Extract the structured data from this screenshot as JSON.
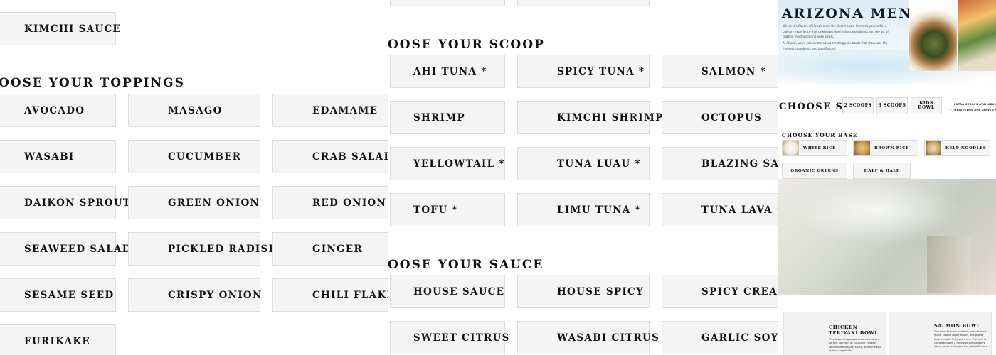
{
  "left": {
    "sauce_continued": {
      "label": "KIMCHI SAUCE"
    },
    "toppings_heading": "OOSE YOUR TOPPINGS",
    "toppings": [
      [
        "AVOCADO",
        "MASAGO",
        "EDAMAME"
      ],
      [
        "WASABI",
        "CUCUMBER",
        "CRAB SALAD"
      ],
      [
        "DAIKON SPROUT",
        "GREEN ONION",
        "RED ONION"
      ],
      [
        "SEAWEED SALAD",
        "PICKLED RADISH",
        "GINGER"
      ],
      [
        "SESAME SEED",
        "CRISPY ONION",
        "CHILI FLAKES"
      ],
      [
        "FURIKAKE"
      ]
    ]
  },
  "middle": {
    "scoop_heading": "OOSE YOUR SCOOP",
    "scoops": [
      [
        "AHI TUNA *",
        "SPICY TUNA *",
        "SALMON *"
      ],
      [
        "SHRIMP",
        "KIMCHI SHRIMP",
        "OCTOPUS"
      ],
      [
        "YELLOWTAIL *",
        "TUNA LUAU *",
        "BLAZING SALMON"
      ],
      [
        "TOFU *",
        "LIMU TUNA *",
        "TUNA LAVA *"
      ]
    ],
    "sauce_heading": "OOSE YOUR SAUCE",
    "sauces": [
      [
        "HOUSE SAUCE",
        "HOUSE SPICY",
        "SPICY CREAMY"
      ],
      [
        "SWEET CITRUS",
        "WASABI CITRUS",
        "GARLIC SOY MIRIN"
      ]
    ]
  },
  "right": {
    "title": "ARIZONA MENU",
    "intro": "Where the flavors of Hawaii meet the desert oasis. Immerse yourself in a culinary experience that celebrates the freshest ingredients and the art of crafting mouthwatering poke bowls.",
    "intro2": "At Alipoki, we're passionate about creating poke bowls that showcase the freshest ingredients and bold flavors.",
    "size_label": "CHOOSE SIZE",
    "sizes": [
      "2 SCOOPS",
      "3 SCOOPS",
      "KIDS BOWL"
    ],
    "size_note_1": "EXTRA SCOOPS AVAILABLE",
    "size_note_2": "* THESE ITEMS ARE SERVED RAW",
    "base_label": "CHOOSE YOUR BASE",
    "bases": [
      "WHITE RICE",
      "BROWN RICE",
      "KELP NOODLES",
      "ORGANIC GREENS",
      "HALF & HALF"
    ],
    "cards": [
      {
        "title": "CHICKEN TERIYAKI BOWL",
        "desc": "This flavorful Japanese-inspired bowl is a perfect harmony of succulent chicken, caramelized teriyaki sauce, and a medley of fresh vegetables."
      },
      {
        "title": "SALMON BOWL",
        "desc": "This bowl features perfectly grilled salmon fillets, cooked to perfection, and placed atop a bed of fluffy sushi rice. The bowl is completed with a drizzle of our signature sauce, which enhances the natural flavors."
      }
    ],
    "colors": {
      "tile_bg": "#f4f4f4",
      "tile_border": "#dcdcdc",
      "text": "#111111"
    }
  }
}
